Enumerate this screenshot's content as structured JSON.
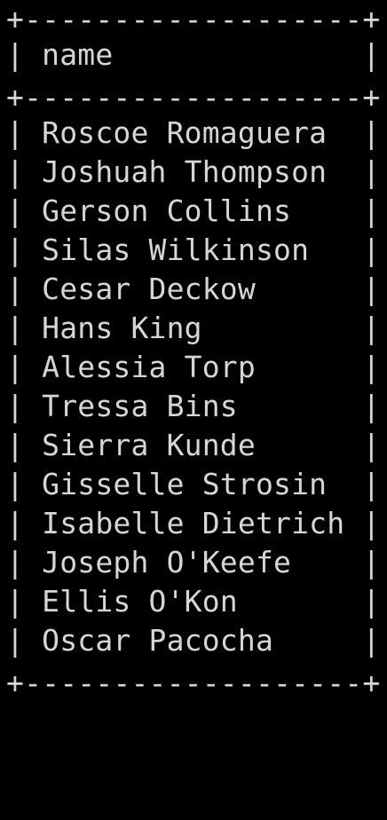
{
  "table": {
    "border_line": "+-------------------+",
    "column_header": "| name              |",
    "rows": [
      "| Roscoe Romaguera  |",
      "| Joshuah Thompson  |",
      "| Gerson Collins    |",
      "| Silas Wilkinson   |",
      "| Cesar Deckow      |",
      "| Hans King         |",
      "| Alessia Torp      |",
      "| Tressa Bins       |",
      "| Sierra Kunde      |",
      "| Gisselle Strosin  |",
      "| Isabelle Dietrich |",
      "| Joseph O'Keefe    |",
      "| Ellis O'Kon       |",
      "| Oscar Pacocha     |"
    ]
  },
  "colors": {
    "background": "#000000",
    "text": "#d6d6d6"
  }
}
